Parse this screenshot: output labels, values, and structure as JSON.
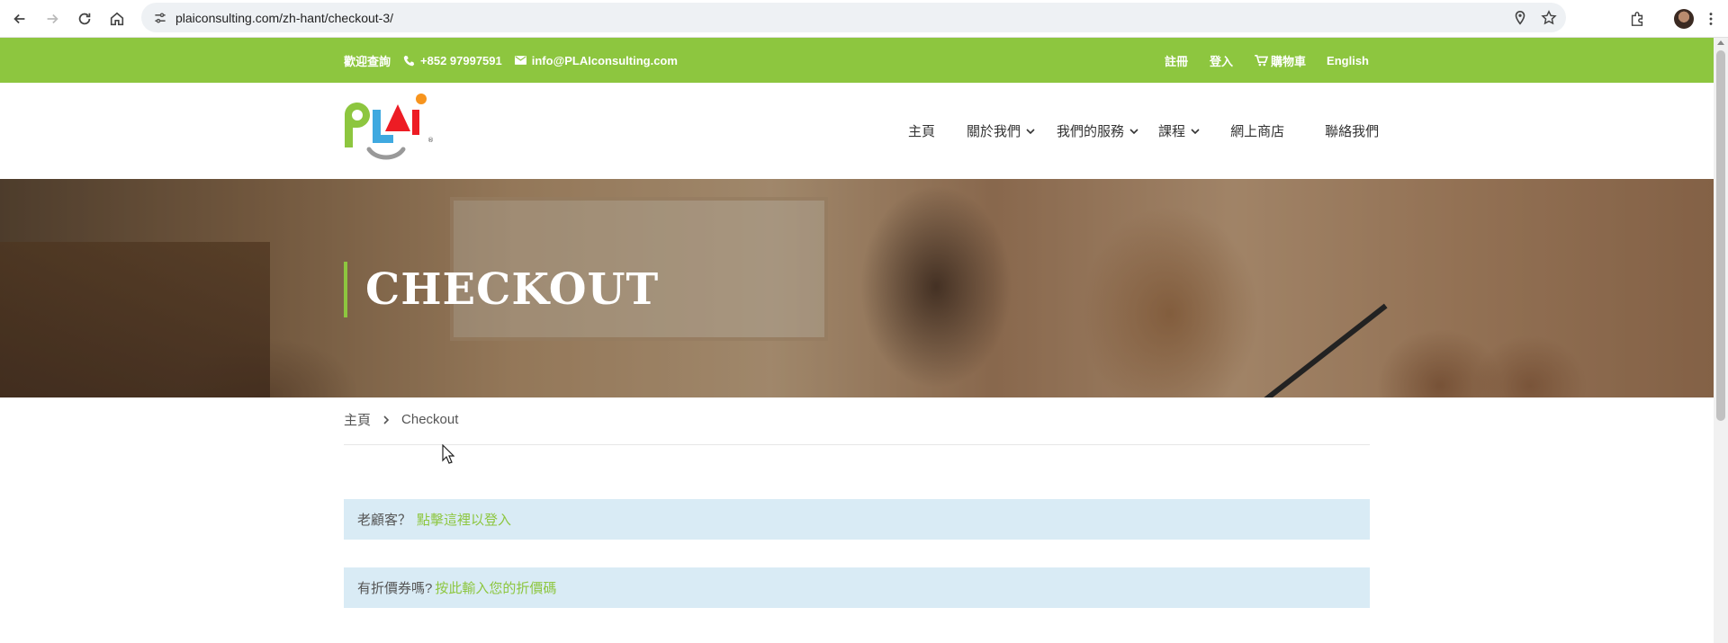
{
  "browser": {
    "url": "plaiconsulting.com/zh-hant/checkout-3/"
  },
  "topbar": {
    "welcome": "歡迎查詢",
    "phone": "+852 97997591",
    "email": "info@PLAIconsulting.com",
    "register": "註冊",
    "login": "登入",
    "cart": "購物車",
    "language": "English"
  },
  "nav": {
    "items": [
      {
        "label": "主頁",
        "dropdown": false
      },
      {
        "label": "關於我們",
        "dropdown": true
      },
      {
        "label": "我們的服務",
        "dropdown": true
      },
      {
        "label": "課程",
        "dropdown": true
      },
      {
        "label": "網上商店",
        "dropdown": false
      },
      {
        "label": "聯絡我們",
        "dropdown": false
      }
    ]
  },
  "hero": {
    "title": "CHECKOUT"
  },
  "breadcrumb": {
    "home": "主頁",
    "current": "Checkout"
  },
  "notices": {
    "returning": {
      "text": "老顧客？",
      "link": "點擊這裡以登入"
    },
    "coupon": {
      "text": "有折價券嗎?",
      "link": "按此輸入您的折價碼"
    }
  },
  "colors": {
    "brand_green": "#8dc63f",
    "notice_bg": "#d9ebf5"
  }
}
